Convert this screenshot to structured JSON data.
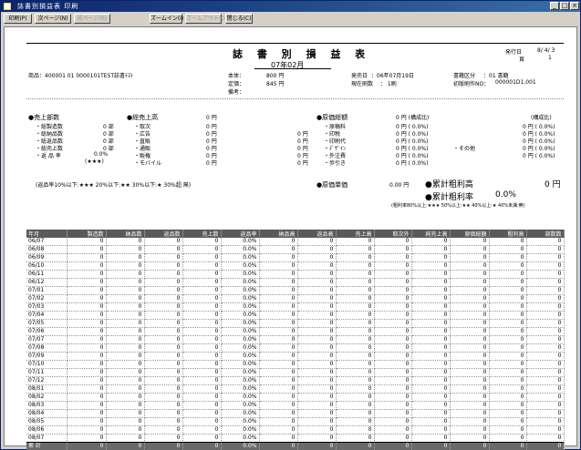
{
  "window": {
    "title": "誌書別損益表 印刷"
  },
  "toolbar": {
    "buttons": [
      "印刷(P)",
      "次ページ(N)",
      "前ページ(B)",
      "ズームイン(I)",
      "ズームアウト(O)",
      "閉じる(C)"
    ]
  },
  "report": {
    "title": "誌 書 別 損 益 表",
    "period": "07年02月",
    "issue_date_label": "発行日",
    "issue_date": "8/ 4/ 3",
    "page_label": "頁",
    "page_no": "1",
    "product": "商品：400001 01  0000101TEST誌書ﾃｽﾄ",
    "price_label": "本体：",
    "price": "800 円",
    "list_label": "定価：",
    "list_price": "845 円",
    "note_label": "備考：",
    "release_label": "発売日",
    "release": "：06年07月19日",
    "stock_label": "現在刷数",
    "stock": "：      1刷",
    "category_label": "書籍区分",
    "category": "：01 書籍",
    "first_label": "初版刷作NO：",
    "first_no": "000001D1,001"
  },
  "sales_units": {
    "head": "●売上部数",
    "rows": [
      {
        "label": "・総製造数",
        "value": "0 部"
      },
      {
        "label": "・総納品数",
        "value": "0 部"
      },
      {
        "label": "・総返品数",
        "value": "0 部"
      },
      {
        "label": "・総売上数",
        "value": "0 部"
      },
      {
        "label": "・返 品 率",
        "value": "0.0%"
      }
    ],
    "stars": "(★★★)"
  },
  "sales_amount": {
    "head": "●総売上高",
    "head_value": "0 円",
    "rows": [
      {
        "label": "・取次",
        "value": "0 円",
        "sub": ""
      },
      {
        "label": "・広告",
        "value": "0 円",
        "sub": "0 円"
      },
      {
        "label": "・直販",
        "value": "0 円",
        "sub": "0 円"
      },
      {
        "label": "・通販",
        "value": "0 円",
        "sub": "0 円"
      },
      {
        "label": "・販権",
        "value": "0 円",
        "sub": "0 円"
      },
      {
        "label": "・モバイル",
        "value": "0 円",
        "sub": "0 円"
      }
    ]
  },
  "cost": {
    "head": "●原価総額",
    "head_value": "0 円 (構成比)",
    "right_head": "(構成比)",
    "rows": [
      {
        "label": "・原稿料",
        "value": "0 円 ( 0.0%)"
      },
      {
        "label": "・印税",
        "value": "0 円 ( 0.0%)"
      },
      {
        "label": "・印刷代",
        "value": "0 円 ( 0.0%)"
      },
      {
        "label": "・ﾃﾞｻﾞｲﾝ",
        "value": "0 円 ( 0.0%)"
      },
      {
        "label": "・外注費",
        "value": "0 円 ( 0.0%)"
      },
      {
        "label": "・歩引き",
        "value": "0 円 ( 0.0%)"
      }
    ],
    "other_label": "・その他",
    "right_values": [
      "0 円 ( 0.0%)",
      "0 円 ( 0.0%)",
      "0 円 ( 0.0%)",
      "0 円 ( 0.0%)",
      "0 円 ( 0.0%)"
    ]
  },
  "unit_cost": {
    "label": "●原価単価",
    "value": "0.00 円"
  },
  "gross": {
    "profit_label": "●累計粗利高",
    "profit_value": "0 円",
    "rate_label": "●累計粗利率",
    "rate_value": "0.0%",
    "legend": "(粗利率80%以上:★★★  50%以上:★★  40%以上:★  40%未満:無)"
  },
  "return_legend": "(返品率10%以下:★★★  20%以下:★★  30%以下:★  30%超:無)",
  "grid": {
    "headers": [
      "年月",
      "製造数",
      "納品数",
      "返品数",
      "売上数",
      "返品率",
      "納品高",
      "返品高",
      "売上高",
      "取次外",
      "純売上高",
      "原価総額",
      "粗利高",
      "部数数"
    ],
    "months": [
      "06/07",
      "06/08",
      "06/09",
      "06/10",
      "06/11",
      "06/12",
      "07/01",
      "07/02",
      "07/03",
      "07/04",
      "07/05",
      "07/06",
      "07/07",
      "07/08",
      "07/09",
      "07/10",
      "07/11",
      "07/12",
      "08/01",
      "08/02",
      "08/03",
      "08/04",
      "08/05",
      "08/06",
      "08/07"
    ],
    "zero": "0",
    "rate": "0.0%",
    "total_label": "累 計"
  }
}
